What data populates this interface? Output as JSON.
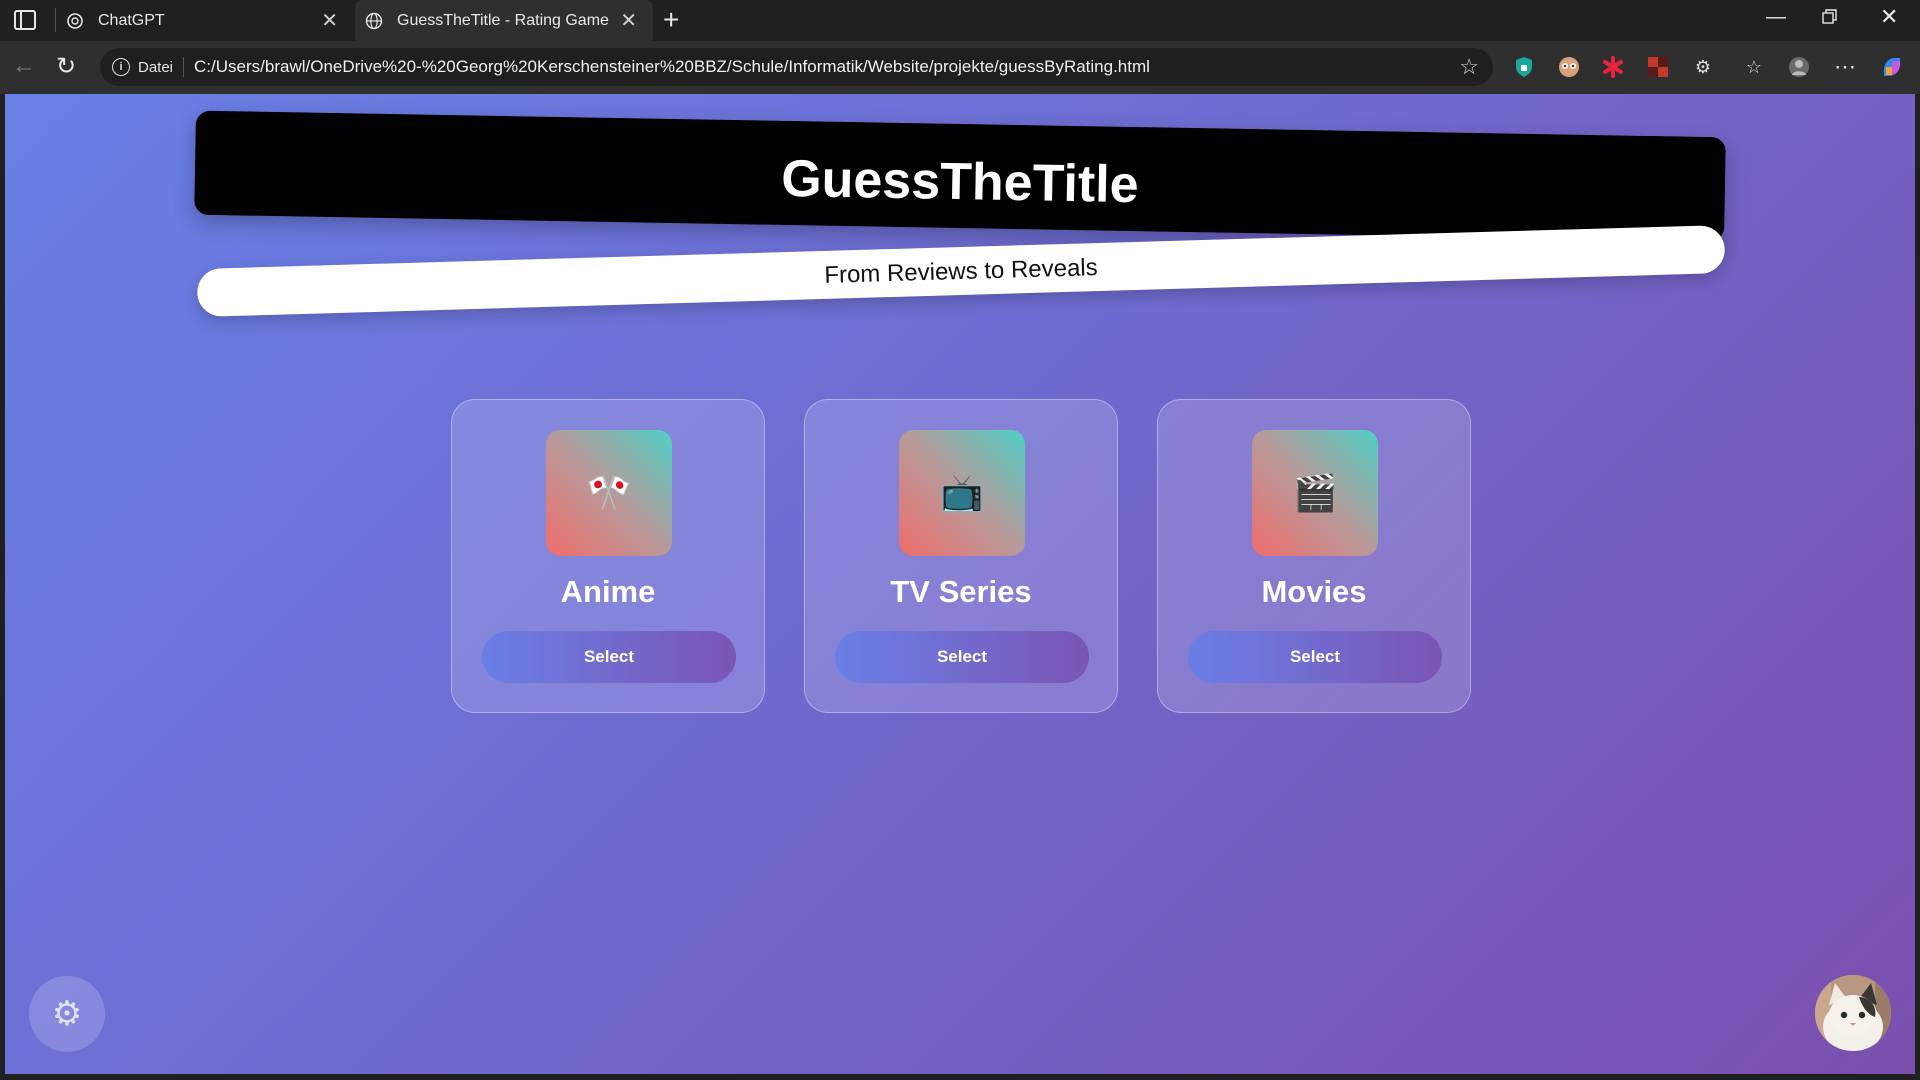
{
  "browser": {
    "tabs": [
      {
        "title": "ChatGPT",
        "icon": "chatgpt-logo-icon"
      },
      {
        "title": "GuessTheTitle - Rating Game",
        "icon": "globe-icon",
        "active": true
      }
    ],
    "address": {
      "label": "Datei",
      "url": "C:/Users/brawl/OneDrive%20-%20Georg%20Kerschensteiner%20BBZ/Schule/Informatik/Website/projekte/guessByRating.html"
    }
  },
  "page": {
    "title": "GuessTheTitle",
    "subtitle": "From Reviews to Reveals",
    "categories": [
      {
        "label": "Anime",
        "icon": "🎌",
        "button": "Select"
      },
      {
        "label": "TV Series",
        "icon": "📺",
        "button": "Select"
      },
      {
        "label": "Movies",
        "icon": "🎬",
        "button": "Select"
      }
    ],
    "settings_icon": "gear-icon",
    "avatar": "cat-avatar"
  },
  "colors": {
    "bg_start": "#6880e6",
    "bg_end": "#7a4fae",
    "card_icon_red": "#f06c6c",
    "card_icon_teal": "#4fd0c6"
  }
}
